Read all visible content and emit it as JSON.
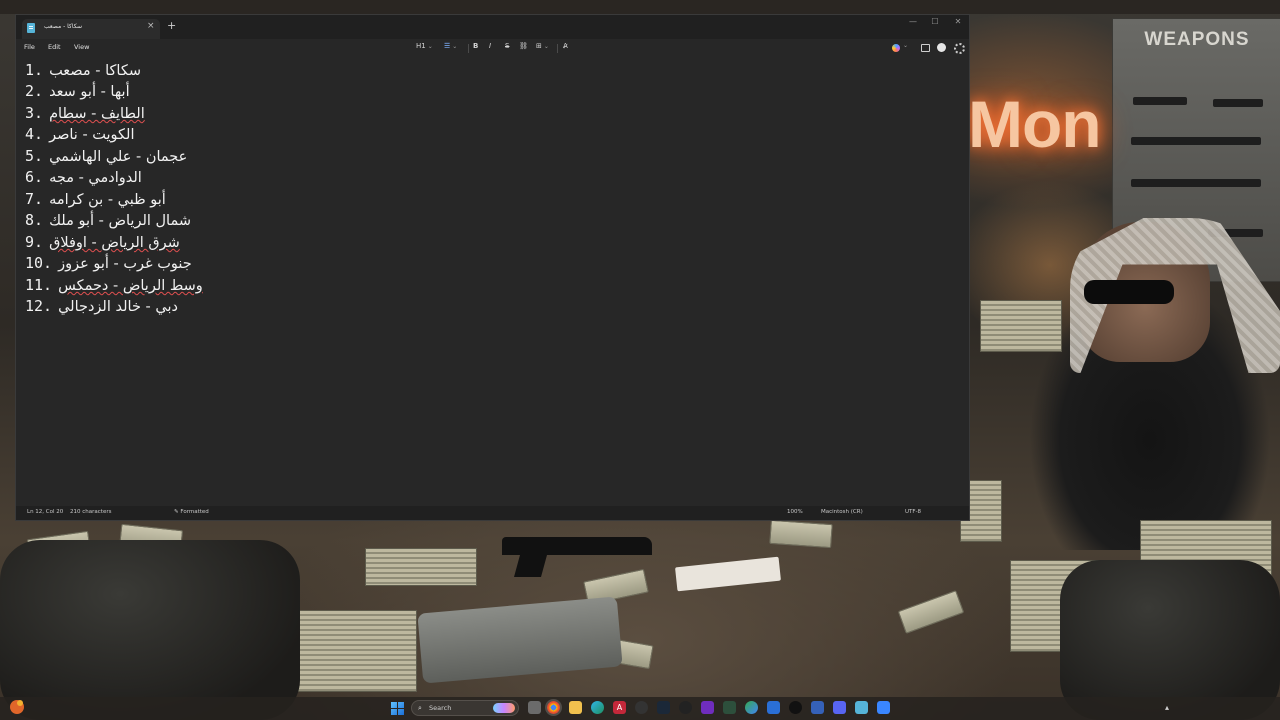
{
  "window": {
    "tab_title": "سكاكا - مصعب",
    "tab_close": "×",
    "new_tab": "+",
    "controls": {
      "minimize": "—",
      "maximize": "☐",
      "close": "✕"
    }
  },
  "menu": {
    "file": "File",
    "edit": "Edit",
    "view": "View"
  },
  "toolbar": {
    "heading": "H1",
    "list": "☰",
    "bold": "B",
    "italic": "I",
    "strikethrough": "S",
    "link": "⛓",
    "table": "⊞",
    "clear_format": "A̷",
    "chevron": "⌄"
  },
  "document": {
    "lines": [
      {
        "num": "1.",
        "text": "سكاكا - مصعب"
      },
      {
        "num": "2.",
        "text": "أبها - أبو سعد"
      },
      {
        "num": "3.",
        "text": "الطايف - سطام"
      },
      {
        "num": "4.",
        "text": "الكويت - ناصر"
      },
      {
        "num": "5.",
        "text": "عجمان - علي الهاشمي"
      },
      {
        "num": "6.",
        "text": "الدوادمي - مجه"
      },
      {
        "num": "7.",
        "text": "أبو ظبي - بن كرامه"
      },
      {
        "num": "8.",
        "text": "شمال الرياض - أبو ملك"
      },
      {
        "num": "9.",
        "text": "شرق الرياض - اوفلاق"
      },
      {
        "num": "10.",
        "text": "جنوب غرب - أبو عزوز"
      },
      {
        "num": "11.",
        "text": "وسط الرياض - دحمكس"
      },
      {
        "num": "12.",
        "text": "دبي - خالد الزدجالي"
      }
    ]
  },
  "status": {
    "position": "Ln 12, Col 20",
    "characters": "210 characters",
    "format_icon": "✎",
    "format": "Formatted",
    "zoom": "100%",
    "line_ending": "Macintosh (CR)",
    "encoding": "UTF-8"
  },
  "wallpaper": {
    "poster_title": "WEAPONS",
    "neon_sign": "Mon"
  },
  "taskbar": {
    "search_placeholder": "Search",
    "search_icon": "⌕"
  }
}
